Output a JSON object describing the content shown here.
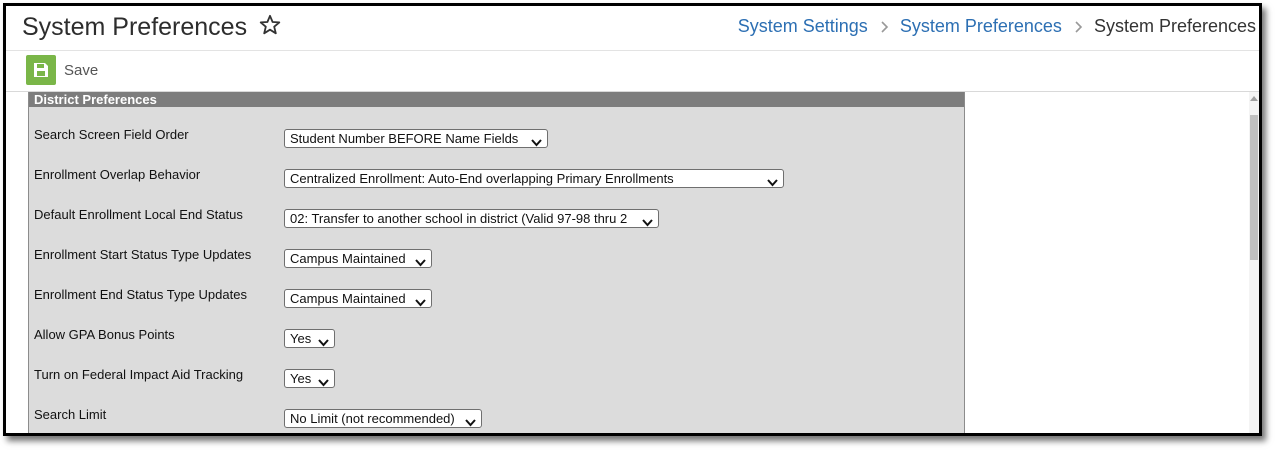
{
  "header": {
    "title": "System Preferences",
    "breadcrumb": {
      "items": [
        "System Settings",
        "System Preferences"
      ],
      "current": "System Preferences"
    }
  },
  "toolbar": {
    "save_label": "Save"
  },
  "panel": {
    "title": "District Preferences",
    "rows": [
      {
        "label": "Search Screen Field Order",
        "value": "Student Number BEFORE Name Fields"
      },
      {
        "label": "Enrollment Overlap Behavior",
        "value": "Centralized Enrollment: Auto-End overlapping Primary Enrollments"
      },
      {
        "label": "Default Enrollment Local End Status",
        "value": "02: Transfer to another school in district (Valid 97-98 thru 2"
      },
      {
        "label": "Enrollment Start Status Type Updates",
        "value": "Campus Maintained"
      },
      {
        "label": "Enrollment End Status Type Updates",
        "value": "Campus Maintained"
      },
      {
        "label": "Allow GPA Bonus Points",
        "value": "Yes"
      },
      {
        "label": "Turn on Federal Impact Aid Tracking",
        "value": "Yes"
      },
      {
        "label": "Search Limit",
        "value": "No Limit (not recommended)"
      }
    ]
  },
  "colors": {
    "link": "#2c6fb3",
    "save_icon_bg": "#7ab648",
    "panel_header_bg": "#7d7d7d",
    "panel_bg": "#dcdcdc"
  },
  "icons": {
    "favorite": "star-outline-icon",
    "separator": "chevron-right-icon",
    "save": "floppy-disk-icon",
    "dropdown": "chevron-down-icon"
  }
}
